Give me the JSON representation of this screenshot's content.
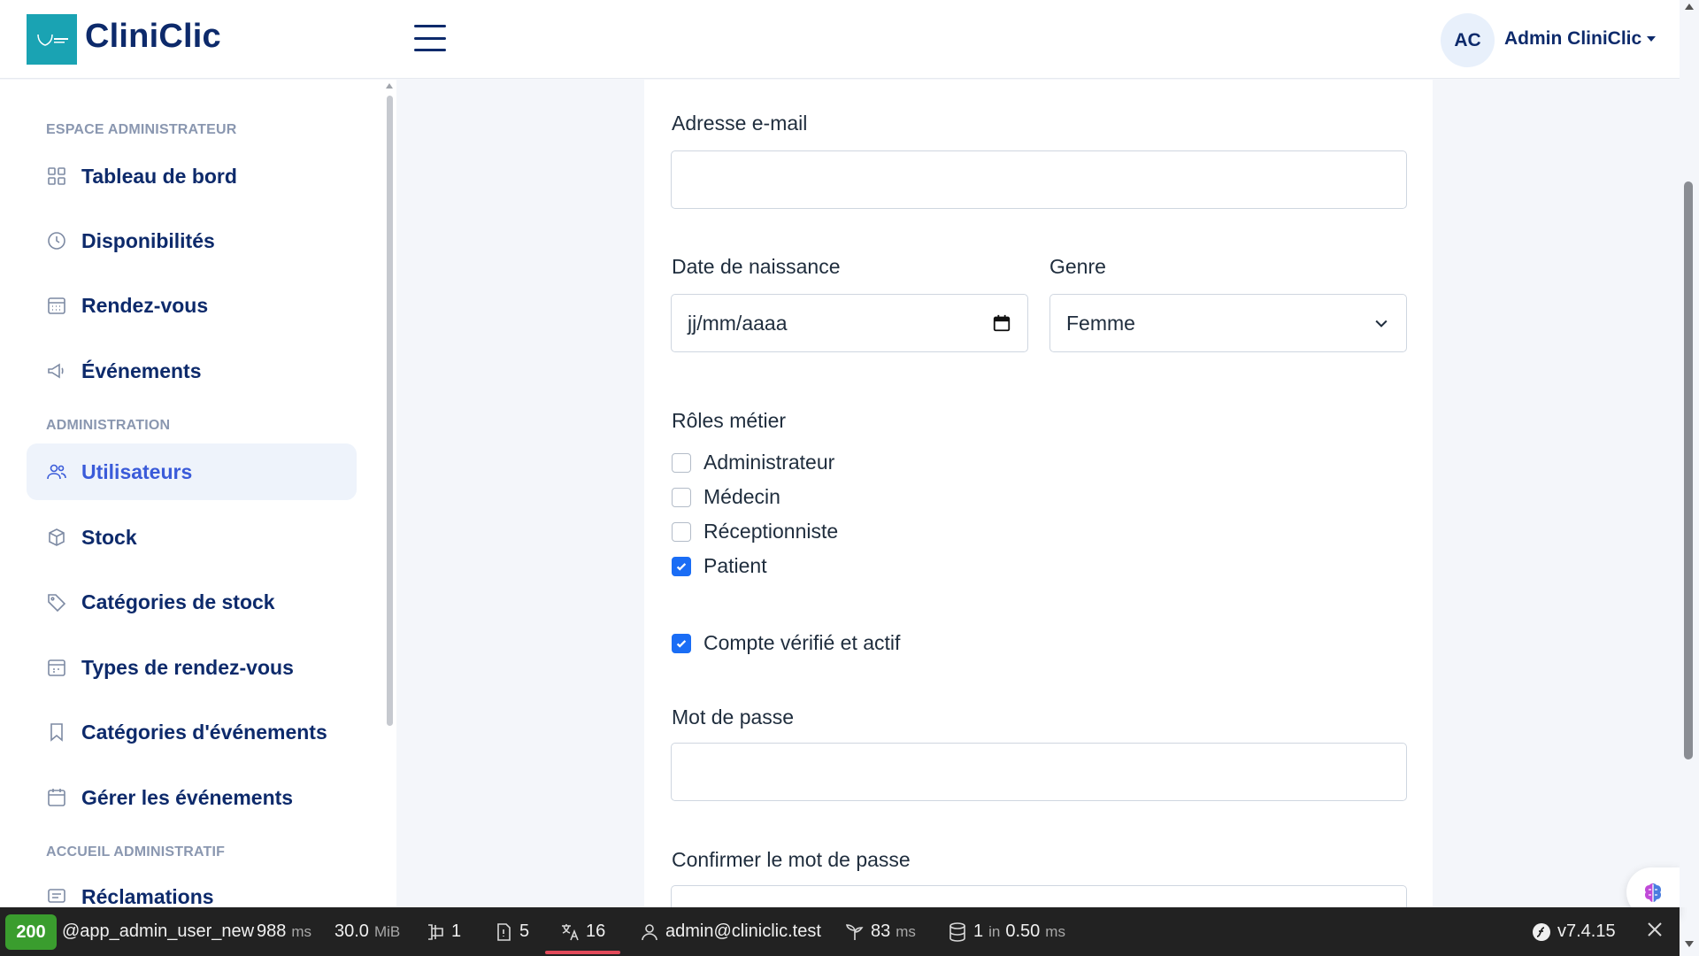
{
  "header": {
    "brand": "CliniClic",
    "avatar_initials": "AC",
    "user_name": "Admin CliniClic"
  },
  "sidebar": {
    "sections": [
      {
        "label": "ESPACE ADMINISTRATEUR"
      },
      {
        "label": "ADMINISTRATION"
      },
      {
        "label": "ACCUEIL ADMINISTRATIF"
      }
    ],
    "items": [
      {
        "label": "Tableau de bord",
        "icon": "grid-icon"
      },
      {
        "label": "Disponibilités",
        "icon": "clock-icon"
      },
      {
        "label": "Rendez-vous",
        "icon": "calendar-grid-icon"
      },
      {
        "label": "Événements",
        "icon": "megaphone-icon"
      },
      {
        "label": "Utilisateurs",
        "icon": "users-icon",
        "active": true
      },
      {
        "label": "Stock",
        "icon": "box-icon"
      },
      {
        "label": "Catégories de stock",
        "icon": "tag-icon"
      },
      {
        "label": "Types de rendez-vous",
        "icon": "calendar-dots-icon"
      },
      {
        "label": "Catégories d'événements",
        "icon": "bookmark-icon"
      },
      {
        "label": "Gérer les événements",
        "icon": "calendar-icon"
      },
      {
        "label": "Réclamations",
        "icon": "message-icon"
      }
    ]
  },
  "form": {
    "email_label": "Adresse e-mail",
    "email_value": "",
    "birthdate_label": "Date de naissance",
    "birthdate_placeholder": "jj/mm/aaaa",
    "gender_label": "Genre",
    "gender_value": "Femme",
    "roles_label": "Rôles métier",
    "roles": [
      {
        "label": "Administrateur",
        "checked": false
      },
      {
        "label": "Médecin",
        "checked": false
      },
      {
        "label": "Réceptionniste",
        "checked": false
      },
      {
        "label": "Patient",
        "checked": true
      }
    ],
    "verified_label": "Compte vérifié et actif",
    "verified_checked": true,
    "password_label": "Mot de passe",
    "confirm_password_label": "Confirmer le mot de passe"
  },
  "debug_toolbar": {
    "status_code": "200",
    "route": "@app_admin_user_new",
    "time_value": "988",
    "time_unit": "ms",
    "memory_value": "30.0",
    "memory_unit": "MiB",
    "forms_count": "1",
    "logs_count": "5",
    "translations_count": "16",
    "user": "admin@cliniclic.test",
    "twig_value": "83",
    "twig_unit": "ms",
    "db_queries": "1",
    "db_in": "in",
    "db_time": "0.50",
    "db_unit": "ms",
    "symfony_version": "v7.4.15"
  },
  "colors": {
    "brand": "#0d2a6b",
    "accent": "#3a5bd9",
    "checkbox": "#1a6df5",
    "status_ok": "#3a9d2e"
  }
}
